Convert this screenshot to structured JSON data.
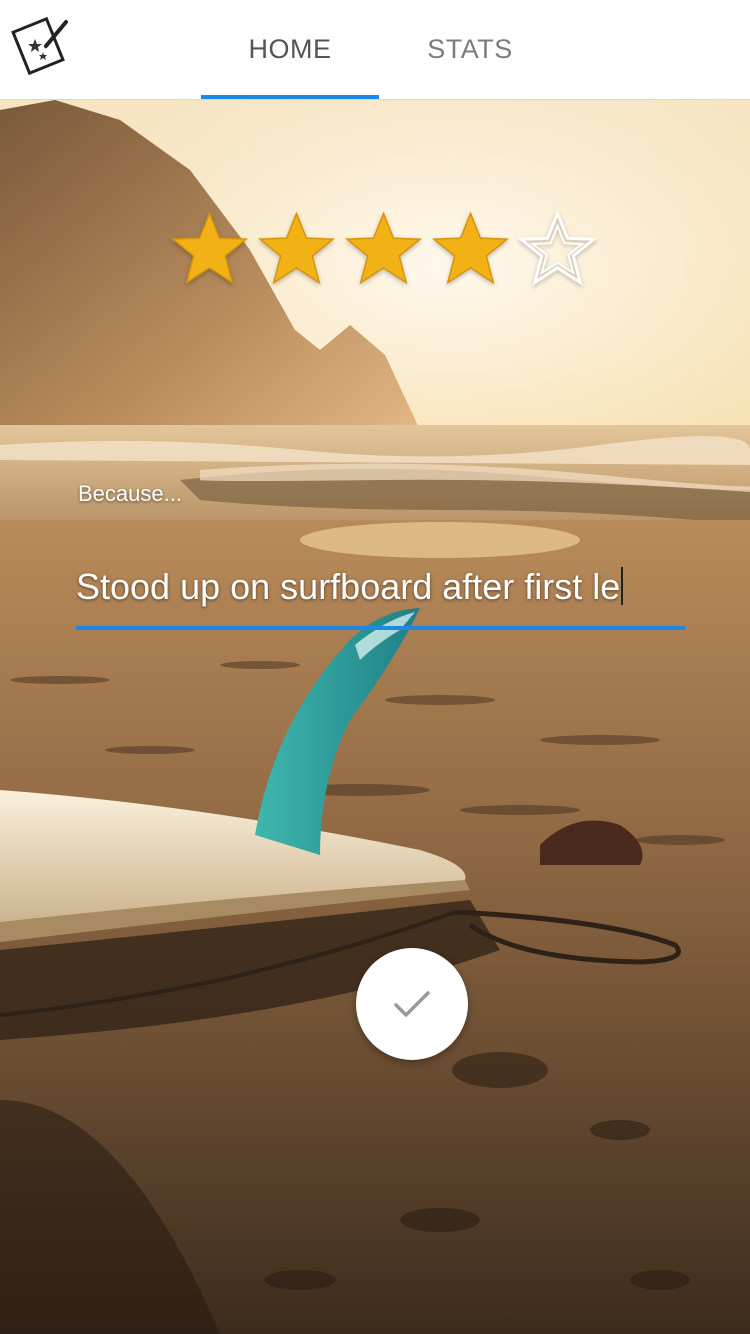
{
  "header": {
    "tabs": [
      {
        "label": "HOME",
        "selected": true
      },
      {
        "label": "STATS",
        "selected": false
      }
    ],
    "accent_color": "#1e88e5"
  },
  "rating": {
    "value": 4,
    "max": 5,
    "filled_color": "#f2b216"
  },
  "reason": {
    "label": "Because...",
    "value": "Stood up on surfboard after first le"
  },
  "submit": {
    "icon": "checkmark-icon"
  }
}
